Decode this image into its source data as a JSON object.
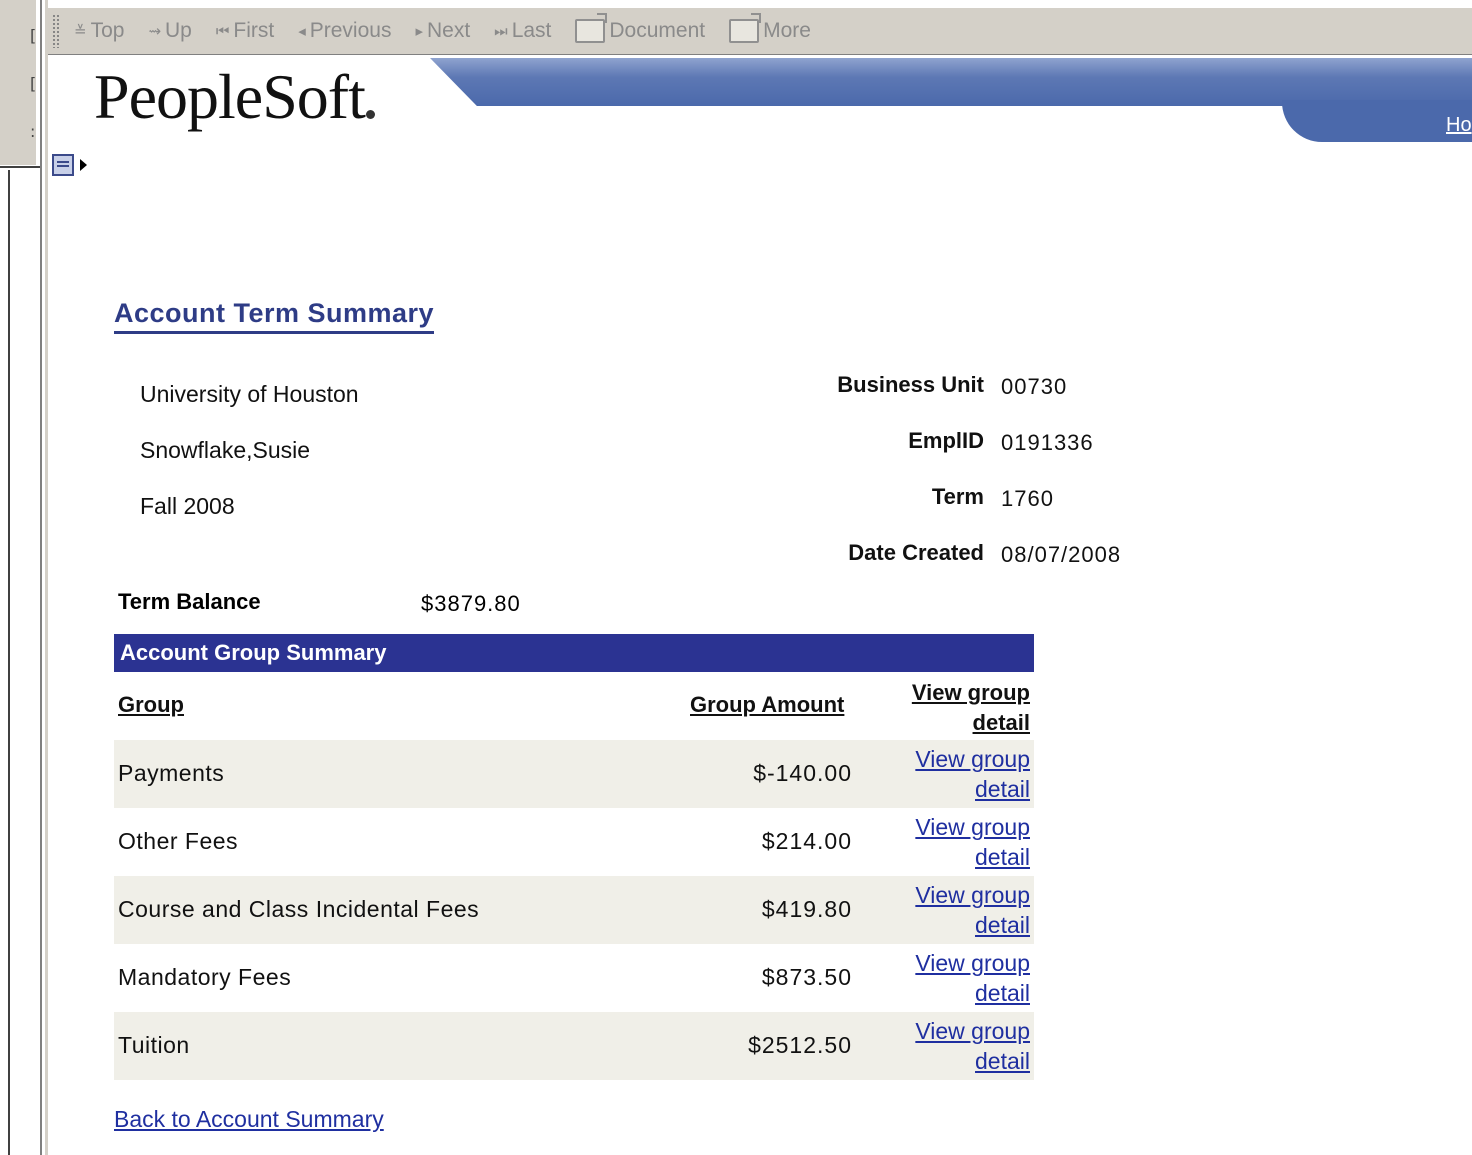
{
  "toolbar": {
    "items": [
      {
        "label": "Top",
        "icon": "top-icon"
      },
      {
        "label": "Up",
        "icon": "up-icon"
      },
      {
        "label": "First",
        "icon": "first-icon"
      },
      {
        "label": "Previous",
        "icon": "previous-icon"
      },
      {
        "label": "Next",
        "icon": "next-icon"
      },
      {
        "label": "Last",
        "icon": "last-icon"
      },
      {
        "label": "Document",
        "icon": "document-folder-icon"
      },
      {
        "label": "More",
        "icon": "more-folder-icon"
      }
    ]
  },
  "header": {
    "logo": "PeopleSoft",
    "home_link": "Ho"
  },
  "page": {
    "title": "Account Term Summary",
    "institution": "University of Houston",
    "student_name": "Snowflake,Susie",
    "term_name": "Fall 2008",
    "business_unit_label": "Business Unit",
    "business_unit": "00730",
    "emplid_label": "EmplID",
    "emplid": "0191336",
    "term_label": "Term",
    "term": "1760",
    "date_created_label": "Date Created",
    "date_created": "08/07/2008",
    "term_balance_label": "Term Balance",
    "term_balance": "$3879.80"
  },
  "grid": {
    "title": "Account Group Summary",
    "col_group": "Group",
    "col_amount": "Group Amount",
    "col_detail_line1": "View group",
    "col_detail_line2": "detail",
    "rows": [
      {
        "group": "Payments",
        "amount": "$-140.00",
        "link1": "View group",
        "link2": "detail"
      },
      {
        "group": "Other Fees",
        "amount": "$214.00",
        "link1": "View group",
        "link2": "detail"
      },
      {
        "group": "Course and Class Incidental Fees",
        "amount": "$419.80",
        "link1": "View group",
        "link2": "detail"
      },
      {
        "group": "Mandatory Fees",
        "amount": "$873.50",
        "link1": "View group",
        "link2": "detail"
      },
      {
        "group": "Tuition",
        "amount": "$2512.50",
        "link1": "View group",
        "link2": "detail"
      }
    ]
  },
  "back_link": "Back to Account Summary",
  "colors": {
    "grid_header": "#2b3392",
    "link": "#1f2fa0",
    "title": "#2e3c86",
    "banner": "#4b69ab",
    "row_shade": "#f0efe8"
  }
}
